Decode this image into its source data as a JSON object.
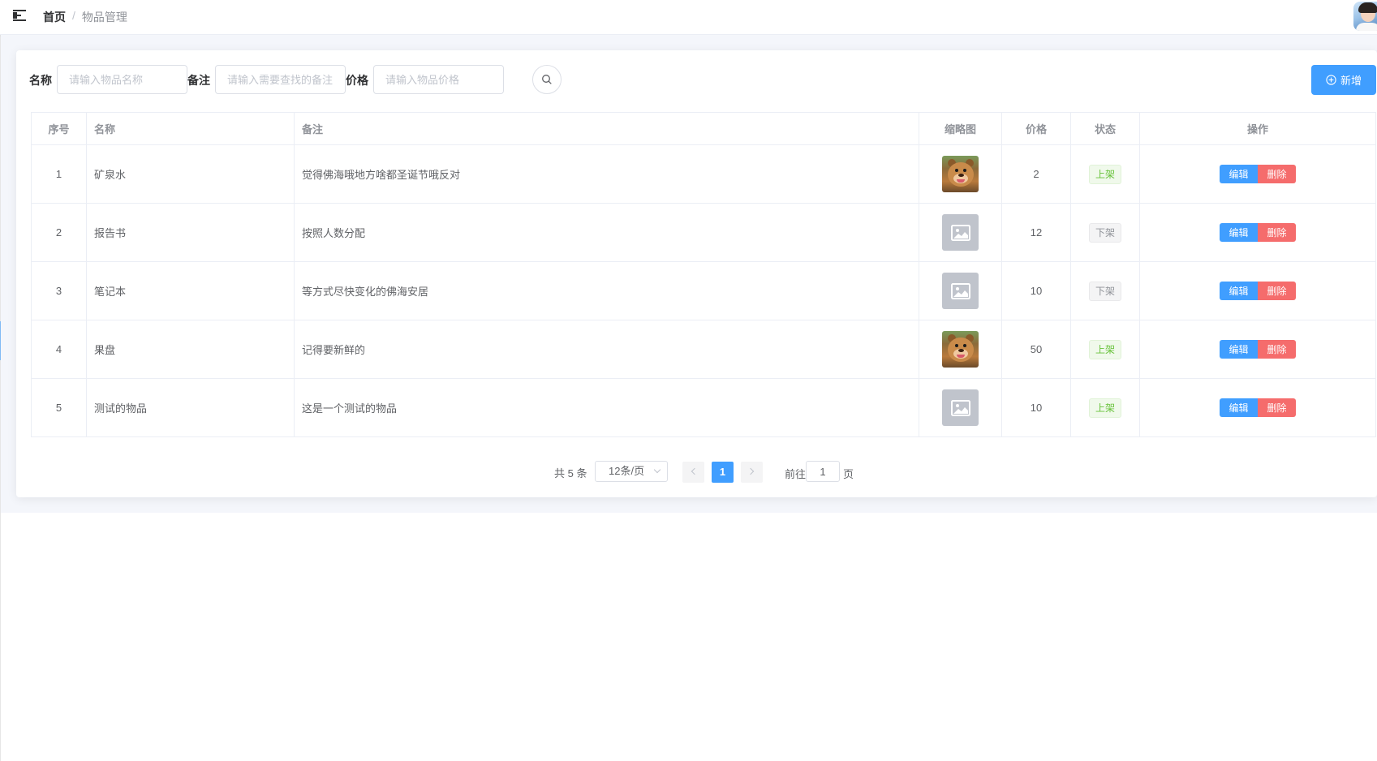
{
  "breadcrumb": {
    "home": "首页",
    "separator": "/",
    "current": "物品管理"
  },
  "search": {
    "name_label": "名称",
    "name_placeholder": "请输入物品名称",
    "remark_label": "备注",
    "remark_placeholder": "请输入需要查找的备注",
    "price_label": "价格",
    "price_placeholder": "请输入物品价格"
  },
  "toolbar": {
    "add_label": "新增"
  },
  "table": {
    "columns": [
      "序号",
      "名称",
      "备注",
      "缩略图",
      "价格",
      "状态",
      "操作"
    ],
    "rows": [
      {
        "index": "1",
        "name": "矿泉水",
        "remark": "觉得佛海哦地方啥都圣诞节哦反对",
        "thumbnail": "bear-image",
        "price": "2",
        "status": "上架"
      },
      {
        "index": "2",
        "name": "报告书",
        "remark": "按照人数分配",
        "thumbnail": "image-placeholder-icon",
        "price": "12",
        "status": "下架"
      },
      {
        "index": "3",
        "name": "笔记本",
        "remark": "等方式尽快变化的佛海安居",
        "thumbnail": "image-placeholder-icon",
        "price": "10",
        "status": "下架"
      },
      {
        "index": "4",
        "name": "果盘",
        "remark": "记得要新鲜的",
        "thumbnail": "bear-image",
        "price": "50",
        "status": "上架"
      },
      {
        "index": "5",
        "name": "测试的物品",
        "remark": "这是一个测试的物品",
        "thumbnail": "image-placeholder-icon",
        "price": "10",
        "status": "上架"
      }
    ],
    "edit_label": "编辑",
    "delete_label": "删除"
  },
  "pagination": {
    "total": "共 5 条",
    "page_size": "12条/页",
    "current_page": "1",
    "goto_prefix": "前往",
    "goto_value": "1",
    "goto_suffix": "页"
  },
  "colors": {
    "primary": "#409eff",
    "danger": "#f56c6c",
    "success": "#67c23a",
    "info": "#909399"
  }
}
